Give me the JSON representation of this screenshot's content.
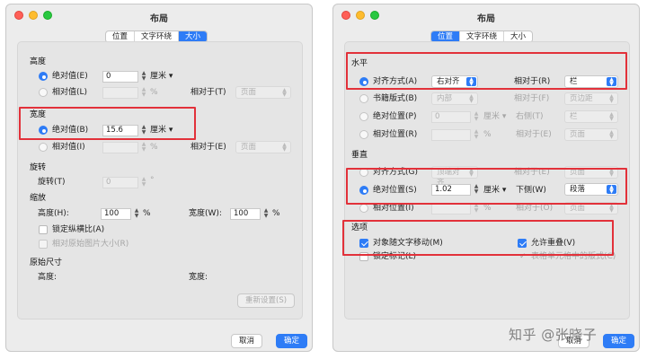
{
  "left": {
    "title": "布局",
    "tabs": [
      "位置",
      "文字环绕",
      "大小"
    ],
    "active_tab": 2,
    "height": {
      "section": "高度",
      "absolute_label": "绝对值(E)",
      "absolute_value": "0",
      "unit": "厘米",
      "relative_label": "相对值(L)",
      "relative_pct": "%",
      "relative_to_label": "相对于(T)",
      "relative_to_value": "页面"
    },
    "width": {
      "section": "宽度",
      "absolute_label": "绝对值(B)",
      "absolute_value": "15.6",
      "unit": "厘米",
      "relative_label": "相对值(I)",
      "relative_pct": "%",
      "relative_to_label": "相对于(E)",
      "relative_to_value": "页面"
    },
    "rotation": {
      "section": "旋转",
      "label": "旋转(T)",
      "value": "0",
      "degree": "°"
    },
    "scale": {
      "section": "缩放",
      "height_label": "高度(H):",
      "height_value": "100",
      "width_label": "宽度(W):",
      "width_value": "100",
      "pct": "%",
      "lock_label": "锁定纵横比(A)",
      "relative_label": "相对原始图片大小(R)"
    },
    "original": {
      "section": "原始尺寸",
      "height_label": "高度:",
      "width_label": "宽度:"
    },
    "reset_label": "重新设置(S)",
    "cancel_label": "取消",
    "ok_label": "确定"
  },
  "right": {
    "title": "布局",
    "tabs": [
      "位置",
      "文字环绕",
      "大小"
    ],
    "active_tab": 0,
    "horizontal": {
      "section": "水平",
      "align_label": "对齐方式(A)",
      "align_value": "右对齐",
      "align_rel_label": "相对于(R)",
      "align_rel_value": "栏",
      "book_label": "书籍版式(B)",
      "book_value": "内部",
      "book_rel_label": "相对于(F)",
      "book_rel_value": "页边距",
      "abs_label": "绝对位置(P)",
      "abs_value": "0",
      "abs_unit": "厘米",
      "abs_rel_label": "右侧(T)",
      "abs_rel_value": "栏",
      "rel_label": "相对位置(R)",
      "rel_pct": "%",
      "rel_rel_label": "相对于(E)",
      "rel_rel_value": "页面"
    },
    "vertical": {
      "section": "垂直",
      "align_label": "对齐方式(G)",
      "align_value": "顶端对齐",
      "align_rel_label": "相对于(E)",
      "align_rel_value": "页面",
      "abs_label": "绝对位置(S)",
      "abs_value": "1.02",
      "abs_unit": "厘米",
      "abs_rel_label": "下侧(W)",
      "abs_rel_value": "段落",
      "rel_label": "相对位置(I)",
      "rel_pct": "%",
      "rel_rel_label": "相对于(O)",
      "rel_rel_value": "页面"
    },
    "options": {
      "section": "选项",
      "move_label": "对象随文字移动(M)",
      "overlap_label": "允许重叠(V)",
      "lock_label": "锁定标记(L)",
      "cell_label": "表格单元格中的版式(C)"
    },
    "cancel_label": "取消",
    "ok_label": "确定"
  },
  "watermark": "知乎 @张晓子",
  "colors": {
    "accent": "#2e7cf6",
    "highlight": "#e2313a"
  }
}
